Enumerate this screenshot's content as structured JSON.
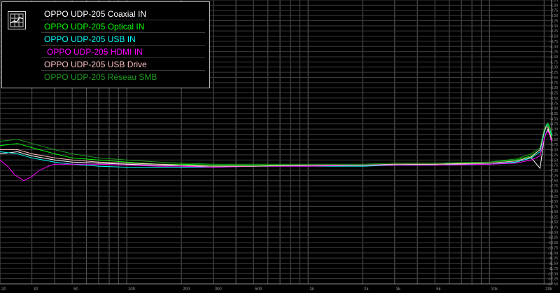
{
  "chart_data": {
    "type": "line",
    "xscale": "log",
    "xlim": [
      20,
      22000
    ],
    "ylim": [
      -12.5,
      1.25
    ],
    "grid": true,
    "legend_position": "top-left",
    "x_tick_labels": [
      "20",
      "30",
      "50",
      "100",
      "200",
      "300",
      "500",
      "1k",
      "2k",
      "3k",
      "5k",
      "10k",
      "20k"
    ],
    "series": [
      {
        "name": "OPPO UDP-205 Coaxial IN",
        "color": "#ffffff",
        "x": [
          20,
          25,
          30,
          40,
          50,
          70,
          100,
          150,
          200,
          300,
          500,
          1000,
          2000,
          3000,
          5000,
          10000,
          14000,
          17000,
          19000,
          20000,
          20500,
          21000,
          21500,
          22000
        ],
        "y": [
          -6.2,
          -6.1,
          -6.3,
          -6.5,
          -6.6,
          -6.65,
          -6.7,
          -6.75,
          -6.8,
          -6.8,
          -6.8,
          -6.75,
          -6.75,
          -6.75,
          -6.7,
          -6.7,
          -6.6,
          -6.4,
          -6.9,
          -5.5,
          -5.2,
          -5.0,
          -5.3,
          -5.6
        ]
      },
      {
        "name": "OPPO UDP-205 Optical IN",
        "color": "#00ff00",
        "x": [
          20,
          25,
          30,
          40,
          50,
          70,
          100,
          150,
          200,
          300,
          500,
          1000,
          2000,
          3000,
          5000,
          10000,
          14000,
          17000,
          19000,
          20000,
          20500,
          21000,
          21500,
          22000
        ],
        "y": [
          -5.8,
          -5.7,
          -5.9,
          -6.2,
          -6.4,
          -6.5,
          -6.6,
          -6.7,
          -6.7,
          -6.75,
          -6.75,
          -6.75,
          -6.75,
          -6.7,
          -6.7,
          -6.6,
          -6.5,
          -6.3,
          -6.0,
          -5.2,
          -4.9,
          -4.8,
          -5.0,
          -5.4
        ]
      },
      {
        "name": "OPPO UDP-205 USB IN",
        "color": "#00ffff",
        "x": [
          20,
          25,
          30,
          40,
          50,
          70,
          100,
          150,
          200,
          300,
          500,
          1000,
          2000,
          3000,
          5000,
          10000,
          14000,
          17000,
          19000,
          20000,
          20500,
          21000,
          21500,
          22000
        ],
        "y": [
          -6.1,
          -6.2,
          -6.4,
          -6.6,
          -6.7,
          -6.8,
          -6.85,
          -6.85,
          -6.85,
          -6.85,
          -6.8,
          -6.8,
          -6.8,
          -6.75,
          -6.75,
          -6.7,
          -6.6,
          -6.4,
          -6.1,
          -5.2,
          -4.9,
          -4.7,
          -4.9,
          -5.3
        ]
      },
      {
        "name": "OPPO UDP-205 HDMI IN",
        "color": "#ff00ff",
        "x": [
          20,
          22,
          24,
          27,
          30,
          33,
          37,
          40,
          45,
          50,
          70,
          100,
          150,
          200,
          300,
          500,
          1000,
          2000,
          3000,
          5000,
          10000,
          14000,
          17000,
          19000,
          20000,
          20500,
          21000,
          21500,
          22000
        ],
        "y": [
          -6.5,
          -6.8,
          -7.2,
          -7.5,
          -7.3,
          -7.0,
          -6.8,
          -6.7,
          -6.7,
          -6.7,
          -6.7,
          -6.75,
          -6.8,
          -6.8,
          -6.85,
          -6.8,
          -6.8,
          -6.75,
          -6.75,
          -6.75,
          -6.7,
          -6.65,
          -6.5,
          -6.3,
          -5.5,
          -5.2,
          -5.1,
          -5.3,
          -5.6
        ]
      },
      {
        "name": "OPPO UDP-205 USB Drive",
        "color": "#ffc0c0",
        "x": [
          20,
          25,
          30,
          40,
          50,
          70,
          100,
          150,
          200,
          300,
          500,
          1000,
          2000,
          3000,
          5000,
          10000,
          14000,
          17000,
          19000,
          20000,
          20500,
          21000,
          21500,
          22000
        ],
        "y": [
          -6.0,
          -6.0,
          -6.2,
          -6.4,
          -6.5,
          -6.6,
          -6.65,
          -6.7,
          -6.75,
          -6.8,
          -6.8,
          -6.75,
          -6.75,
          -6.7,
          -6.7,
          -6.65,
          -6.55,
          -6.35,
          -6.0,
          -5.1,
          -4.9,
          -4.9,
          -5.2,
          -5.5
        ]
      },
      {
        "name": "OPPO UDP-205 Réseau SMB",
        "color": "#1f9a1f",
        "x": [
          20,
          25,
          30,
          40,
          50,
          70,
          100,
          150,
          200,
          300,
          500,
          1000,
          2000,
          3000,
          5000,
          10000,
          14000,
          17000,
          19000,
          20000,
          20500,
          21000,
          21500,
          22000
        ],
        "y": [
          -5.6,
          -5.5,
          -5.7,
          -6.0,
          -6.2,
          -6.4,
          -6.5,
          -6.6,
          -6.65,
          -6.7,
          -6.7,
          -6.7,
          -6.7,
          -6.65,
          -6.65,
          -6.6,
          -6.45,
          -6.2,
          -5.9,
          -5.0,
          -4.8,
          -4.7,
          -4.9,
          -5.2
        ]
      }
    ]
  }
}
